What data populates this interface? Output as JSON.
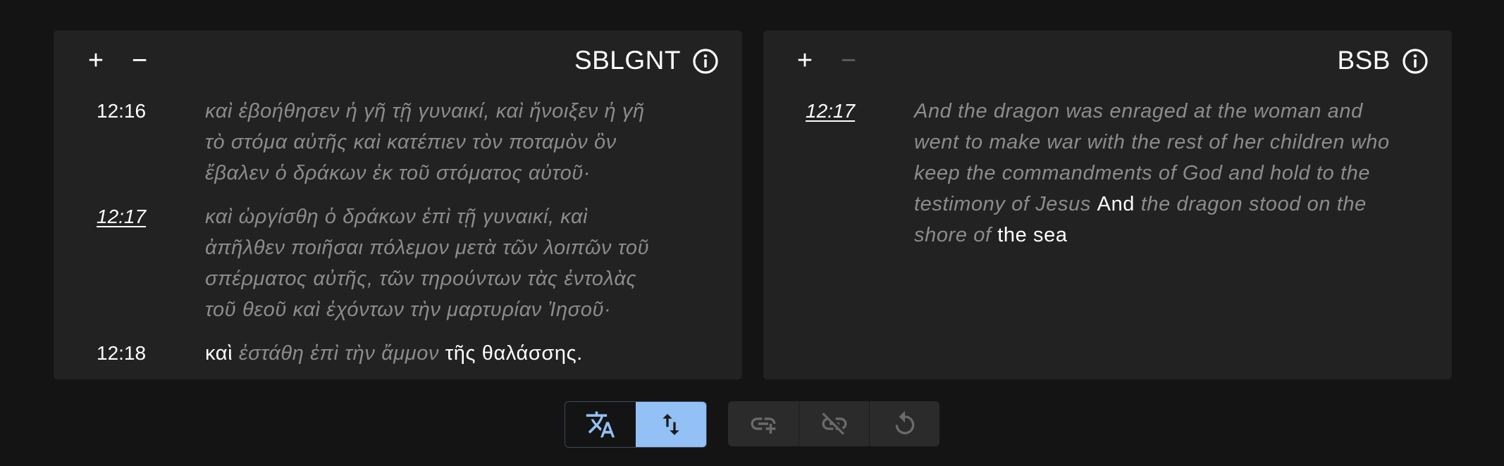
{
  "colors": {
    "background": "#141414",
    "panel": "#222222",
    "text_primary": "#ffffff",
    "text_muted": "#8c8c8c",
    "accent": "#93c0f5",
    "icon_disabled": "#6a6a6a"
  },
  "left_panel": {
    "zoom_in_label": "+",
    "zoom_out_label": "−",
    "title": "SBLGNT",
    "info_icon": "info-circle-icon",
    "verses": [
      {
        "ref": "12:16",
        "lines": [
          "καὶ ἐβοήθησεν ἡ γῆ τῇ γυναικί, καὶ ἤνοιξεν ἡ γῆ",
          "τὸ στόμα αὐτῆς καὶ κατέπιεν τὸν ποταμὸν ὃν",
          "ἔβαλεν ὁ δράκων ἐκ τοῦ στόματος αὐτοῦ·"
        ]
      },
      {
        "ref": "12:17",
        "lines": [
          "καὶ ὠργίσθη ὁ δράκων ἐπὶ τῇ γυναικί, καὶ",
          "ἀπῆλθεν ποιῆσαι πόλεμον μετὰ τῶν λοιπῶν τοῦ",
          "σπέρματος αὐτῆς, τῶν τηρούντων τὰς ἐντολὰς",
          "τοῦ θεοῦ καὶ ἐχόντων τὴν μαρτυρίαν Ἰησοῦ·"
        ]
      },
      {
        "ref": "12:18",
        "segments": [
          "καὶ",
          "ἐστάθη ἐπὶ τὴν ἄμμον",
          "τῆς θαλάσσης."
        ]
      }
    ]
  },
  "right_panel": {
    "zoom_in_label": "+",
    "zoom_out_label": "−",
    "title": "BSB",
    "info_icon": "info-circle-icon",
    "verse": {
      "ref": "12:17",
      "lines": [
        "And the dragon was enraged at the woman and",
        "went to make war with the rest of her children who",
        "keep the commandments of God and hold to the"
      ],
      "line4": [
        "testimony of Jesus",
        "And",
        "the dragon stood on the"
      ],
      "line5": [
        "shore of",
        "the sea"
      ]
    }
  },
  "toolbar": {
    "translate_icon": "translate-icon",
    "reorder_icon": "swap-vertical-icon",
    "add_link_icon": "link-add-icon",
    "unlink_icon": "link-off-icon",
    "reset_icon": "refresh-icon"
  }
}
